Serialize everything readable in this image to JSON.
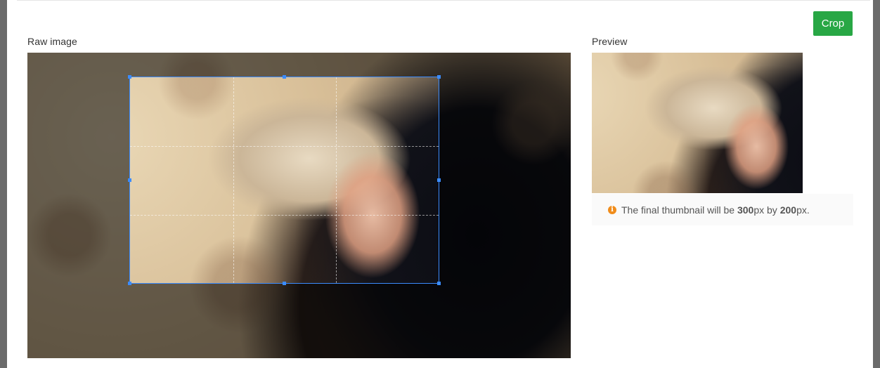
{
  "crop_button": {
    "label": "Crop",
    "color": "#28a745"
  },
  "raw_section": {
    "label": "Raw image"
  },
  "preview_section": {
    "label": "Preview"
  },
  "note": {
    "icon": "info-icon",
    "prefix": "The final thumbnail will be ",
    "width_value": "300",
    "unit1": "px by ",
    "height_value": "200",
    "unit2": "px."
  },
  "selection_color": "#3b8cff"
}
